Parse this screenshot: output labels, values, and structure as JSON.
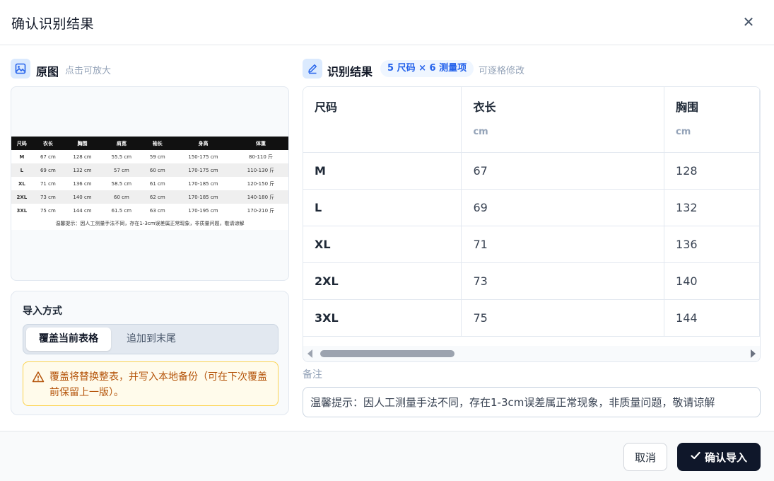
{
  "dialog": {
    "title": "确认识别结果",
    "close_icon": "close-icon"
  },
  "original": {
    "label": "原图",
    "hint": "点击可放大",
    "icon": "image-icon"
  },
  "preview_table": {
    "headers": [
      "尺码",
      "衣长",
      "胸围",
      "肩宽",
      "袖长",
      "身高",
      "体重"
    ],
    "rows": [
      [
        "M",
        "67 cm",
        "128 cm",
        "55.5 cm",
        "59 cm",
        "150-175 cm",
        "80-110 斤"
      ],
      [
        "L",
        "69 cm",
        "132 cm",
        "57 cm",
        "60 cm",
        "170-175 cm",
        "110-130 斤"
      ],
      [
        "XL",
        "71 cm",
        "136 cm",
        "58.5 cm",
        "61 cm",
        "170-185 cm",
        "120-150 斤"
      ],
      [
        "2XL",
        "73 cm",
        "140 cm",
        "60 cm",
        "62 cm",
        "170-185 cm",
        "140-180 斤"
      ],
      [
        "3XL",
        "75 cm",
        "144 cm",
        "61.5 cm",
        "63 cm",
        "170-195 cm",
        "170-210 斤"
      ]
    ],
    "note": "温馨提示：因人工测量手法不同，存在1-3cm误差属正常现象，非质量问题，敬请谅解"
  },
  "import_mode": {
    "title": "导入方式",
    "options": [
      "覆盖当前表格",
      "追加到末尾"
    ],
    "selected": "覆盖当前表格",
    "warning": "覆盖将替换整表，并写入本地备份（可在下次覆盖前保留上一版）。",
    "warning_icon": "warning-triangle-icon",
    "warning_color": "#b45309"
  },
  "result": {
    "label": "识别结果",
    "icon": "edit-pencil-icon",
    "badge": "5 尺码 × 6 测量项",
    "hint": "可逐格修改",
    "columns": [
      {
        "name": "尺码",
        "unit": ""
      },
      {
        "name": "衣长",
        "unit": "cm"
      },
      {
        "name": "胸围",
        "unit": "cm"
      }
    ],
    "rows": [
      [
        "M",
        "67",
        "128"
      ],
      [
        "L",
        "69",
        "132"
      ],
      [
        "XL",
        "71",
        "136"
      ],
      [
        "2XL",
        "73",
        "140"
      ],
      [
        "3XL",
        "75",
        "144"
      ]
    ]
  },
  "note": {
    "label": "备注",
    "value": "温馨提示：因人工测量手法不同，存在1-3cm误差属正常现象，非质量问题，敬请谅解"
  },
  "footer": {
    "cancel_label": "取消",
    "confirm_label": "确认导入",
    "confirm_icon": "check-icon"
  },
  "colors": {
    "accent": "#2563eb",
    "primary_button": "#0f172a",
    "warning_bg": "#fffbeb",
    "warning_border": "#fcd34d"
  }
}
